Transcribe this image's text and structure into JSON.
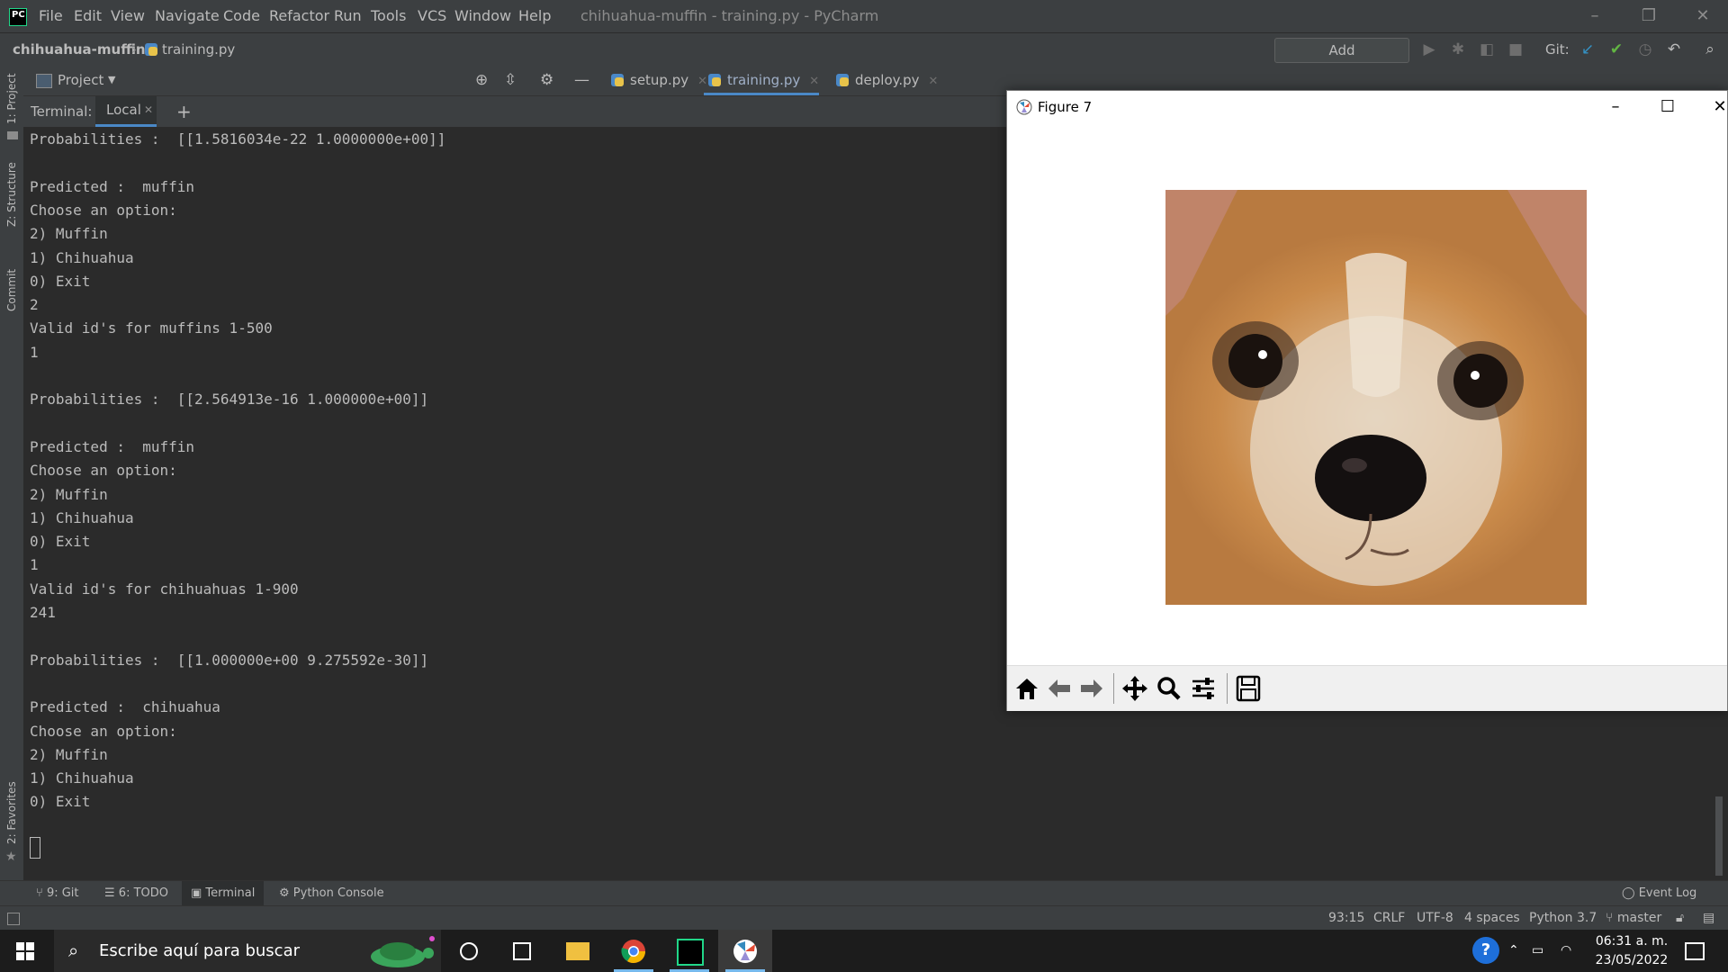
{
  "app": {
    "window_title": "chihuahua-muffin - training.py - PyCharm",
    "menu": [
      "File",
      "Edit",
      "View",
      "Navigate",
      "Code",
      "Refactor",
      "Run",
      "Tools",
      "VCS",
      "Window",
      "Help"
    ]
  },
  "navbar": {
    "project": "chihuahua-muffin",
    "file": "training.py",
    "add_config": "Add Configuration...",
    "git_label": "Git:"
  },
  "left_stripe": {
    "project": "1: Project",
    "structure": "Z: Structure",
    "commit": "Commit",
    "favorites": "2: Favorites"
  },
  "project_panel": {
    "title": "Project"
  },
  "editor_tabs": [
    {
      "label": "setup.py",
      "active": false
    },
    {
      "label": "training.py",
      "active": true
    },
    {
      "label": "deploy.py",
      "active": false
    }
  ],
  "terminal": {
    "label": "Terminal:",
    "tab": "Local",
    "lines": [
      "Probabilities :  [[1.5816034e-22 1.0000000e+00]]",
      "",
      "Predicted :  muffin",
      "Choose an option:",
      "2) Muffin",
      "1) Chihuahua",
      "0) Exit",
      "2",
      "Valid id's for muffins 1-500",
      "1",
      "",
      "Probabilities :  [[2.564913e-16 1.000000e+00]]",
      "",
      "Predicted :  muffin",
      "Choose an option:",
      "2) Muffin",
      "1) Chihuahua",
      "0) Exit",
      "1",
      "Valid id's for chihuahuas 1-900",
      "241",
      "",
      "Probabilities :  [[1.000000e+00 9.275592e-30]]",
      "",
      "Predicted :  chihuahua",
      "Choose an option:",
      "2) Muffin",
      "1) Chihuahua",
      "0) Exit"
    ]
  },
  "bottom_tools": {
    "git": "9: Git",
    "todo": "6: TODO",
    "terminal": "Terminal",
    "python_console": "Python Console",
    "event_log": "Event Log"
  },
  "status": {
    "position": "93:15",
    "line_sep": "CRLF",
    "encoding": "UTF-8",
    "indent": "4 spaces",
    "interpreter": "Python 3.7",
    "branch": "master"
  },
  "figure": {
    "title": "Figure 7",
    "toolbar": [
      "home-icon",
      "back-icon",
      "forward-icon",
      "pan-icon",
      "zoom-icon",
      "configure-icon",
      "save-icon"
    ]
  },
  "taskbar": {
    "search_placeholder": "Escribe aquí para buscar",
    "time": "06:31 a. m.",
    "date": "23/05/2022"
  },
  "colors": {
    "ide_bg": "#2b2b2b",
    "panel_bg": "#3c3f41",
    "accent": "#4a88c7"
  }
}
